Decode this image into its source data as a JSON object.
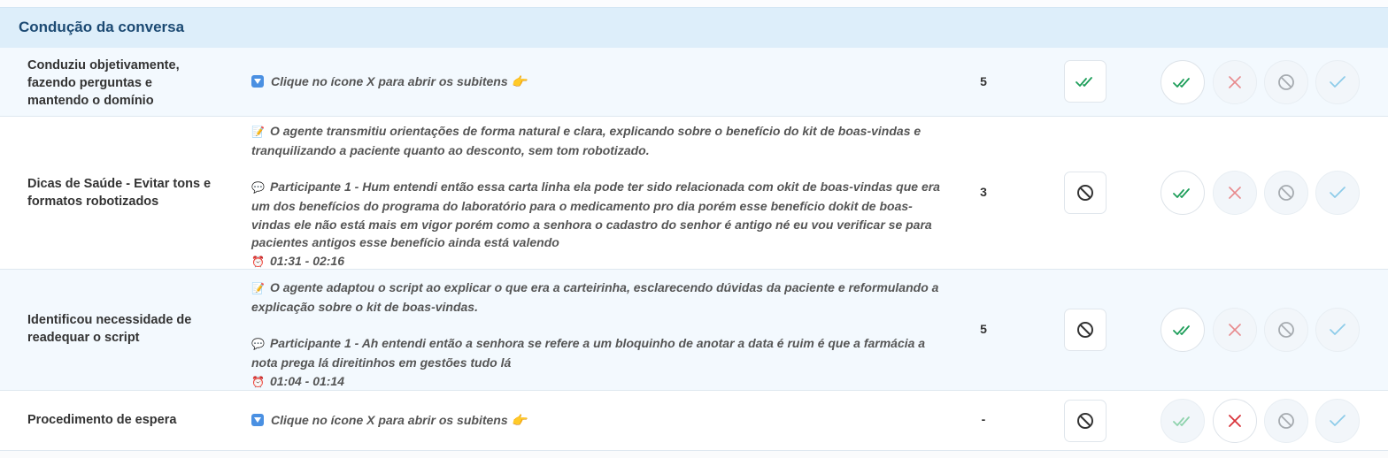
{
  "section": {
    "title": "Condução da conversa"
  },
  "rows": [
    {
      "name": "Conduziu objetivamente, fazendo perguntas e mantendo o domínio",
      "hint": "Clique no ícone X para abrir os subitens 👉",
      "score": "5"
    },
    {
      "name": "Dicas de Saúde - Evitar tons e formatos robotizados",
      "desc_agent": "O agente transmitiu orientações de forma natural e clara, explicando sobre o benefício do kit de boas-vindas e tranquilizando a paciente quanto ao desconto, sem tom robotizado.",
      "desc_quote": "Participante 1 - Hum entendi então essa carta linha ela pode ter sido relacionada com okit de boas-vindas que era um dos benefícios do programa do laboratório para o medicamento pro dia porém esse benefício dokit de boas-vindas ele não está mais em vigor porém como a senhora o cadastro do senhor é antigo né eu vou verificar se para pacientes antigos esse benefício ainda está valendo",
      "desc_time": "01:31 - 02:16",
      "score": "3"
    },
    {
      "name": "Identificou necessidade de readequar o script",
      "desc_agent": "O agente adaptou o script ao explicar o que era a carteirinha, esclarecendo dúvidas da paciente e reformulando a explicação sobre o kit de boas-vindas.",
      "desc_quote": "Participante 1 - Ah entendi então a senhora se refere a um bloquinho de anotar a data é ruim é que a farmácia a nota prega lá direitinhos em gestões tudo lá",
      "desc_time": "01:04 - 01:14",
      "score": "5"
    },
    {
      "name": "Procedimento de espera",
      "hint": "Clique no ícone X para abrir os subitens 👉",
      "score": "-"
    }
  ],
  "emoji": {
    "agent": "📝",
    "quote": "💬",
    "time": "⏰"
  },
  "icons": {
    "approve": "double-check-icon",
    "reject": "x-icon",
    "not_applicable": "ban-icon",
    "check": "check-icon"
  },
  "colors": {
    "green": "#1e9e5a",
    "red": "#e0565b",
    "gray": "#8a9096",
    "blue": "#6db8e0",
    "header_bg": "#ddeefa",
    "title": "#1c4a73"
  }
}
